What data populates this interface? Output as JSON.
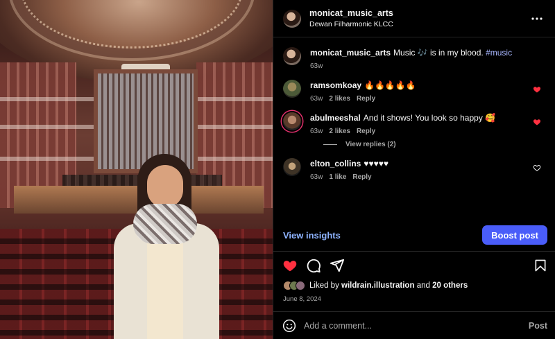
{
  "header": {
    "username": "monicat_music_arts",
    "location": "Dewan Filharmonic KLCC"
  },
  "caption": {
    "username": "monicat_music_arts",
    "text": "Music 🎶 is in my blood.",
    "hashtag": "#music",
    "time": "63w"
  },
  "comments": [
    {
      "username": "ramsomkoay",
      "text": "🔥🔥🔥🔥🔥",
      "time": "63w",
      "likes": "2 likes",
      "reply": "Reply",
      "liked": true
    },
    {
      "username": "abulmeeshal",
      "text": "And it shows! You look so happy 🥰",
      "time": "63w",
      "likes": "2 likes",
      "reply": "Reply",
      "liked": true
    },
    {
      "username": "elton_collins",
      "text": "♥♥♥♥♥",
      "time": "63w",
      "likes": "1 like",
      "reply": "Reply",
      "liked": false
    }
  ],
  "view_replies": "View replies (2)",
  "insights": {
    "link": "View insights",
    "boost": "Boost post"
  },
  "likes": {
    "prefix": "Liked by",
    "user": "wildrain.illustration",
    "and": "and",
    "others": "20 others"
  },
  "date": "June 8, 2024",
  "add_comment": {
    "placeholder": "Add a comment...",
    "post": "Post"
  },
  "colors": {
    "accent": "#4a5df9",
    "like_red": "#ff3040",
    "link_blue": "#8fb4ff",
    "hashtag": "#a8b7ff"
  },
  "icons": [
    "more-icon",
    "heart-icon",
    "comment-icon",
    "share-icon",
    "bookmark-icon",
    "emoji-icon"
  ]
}
